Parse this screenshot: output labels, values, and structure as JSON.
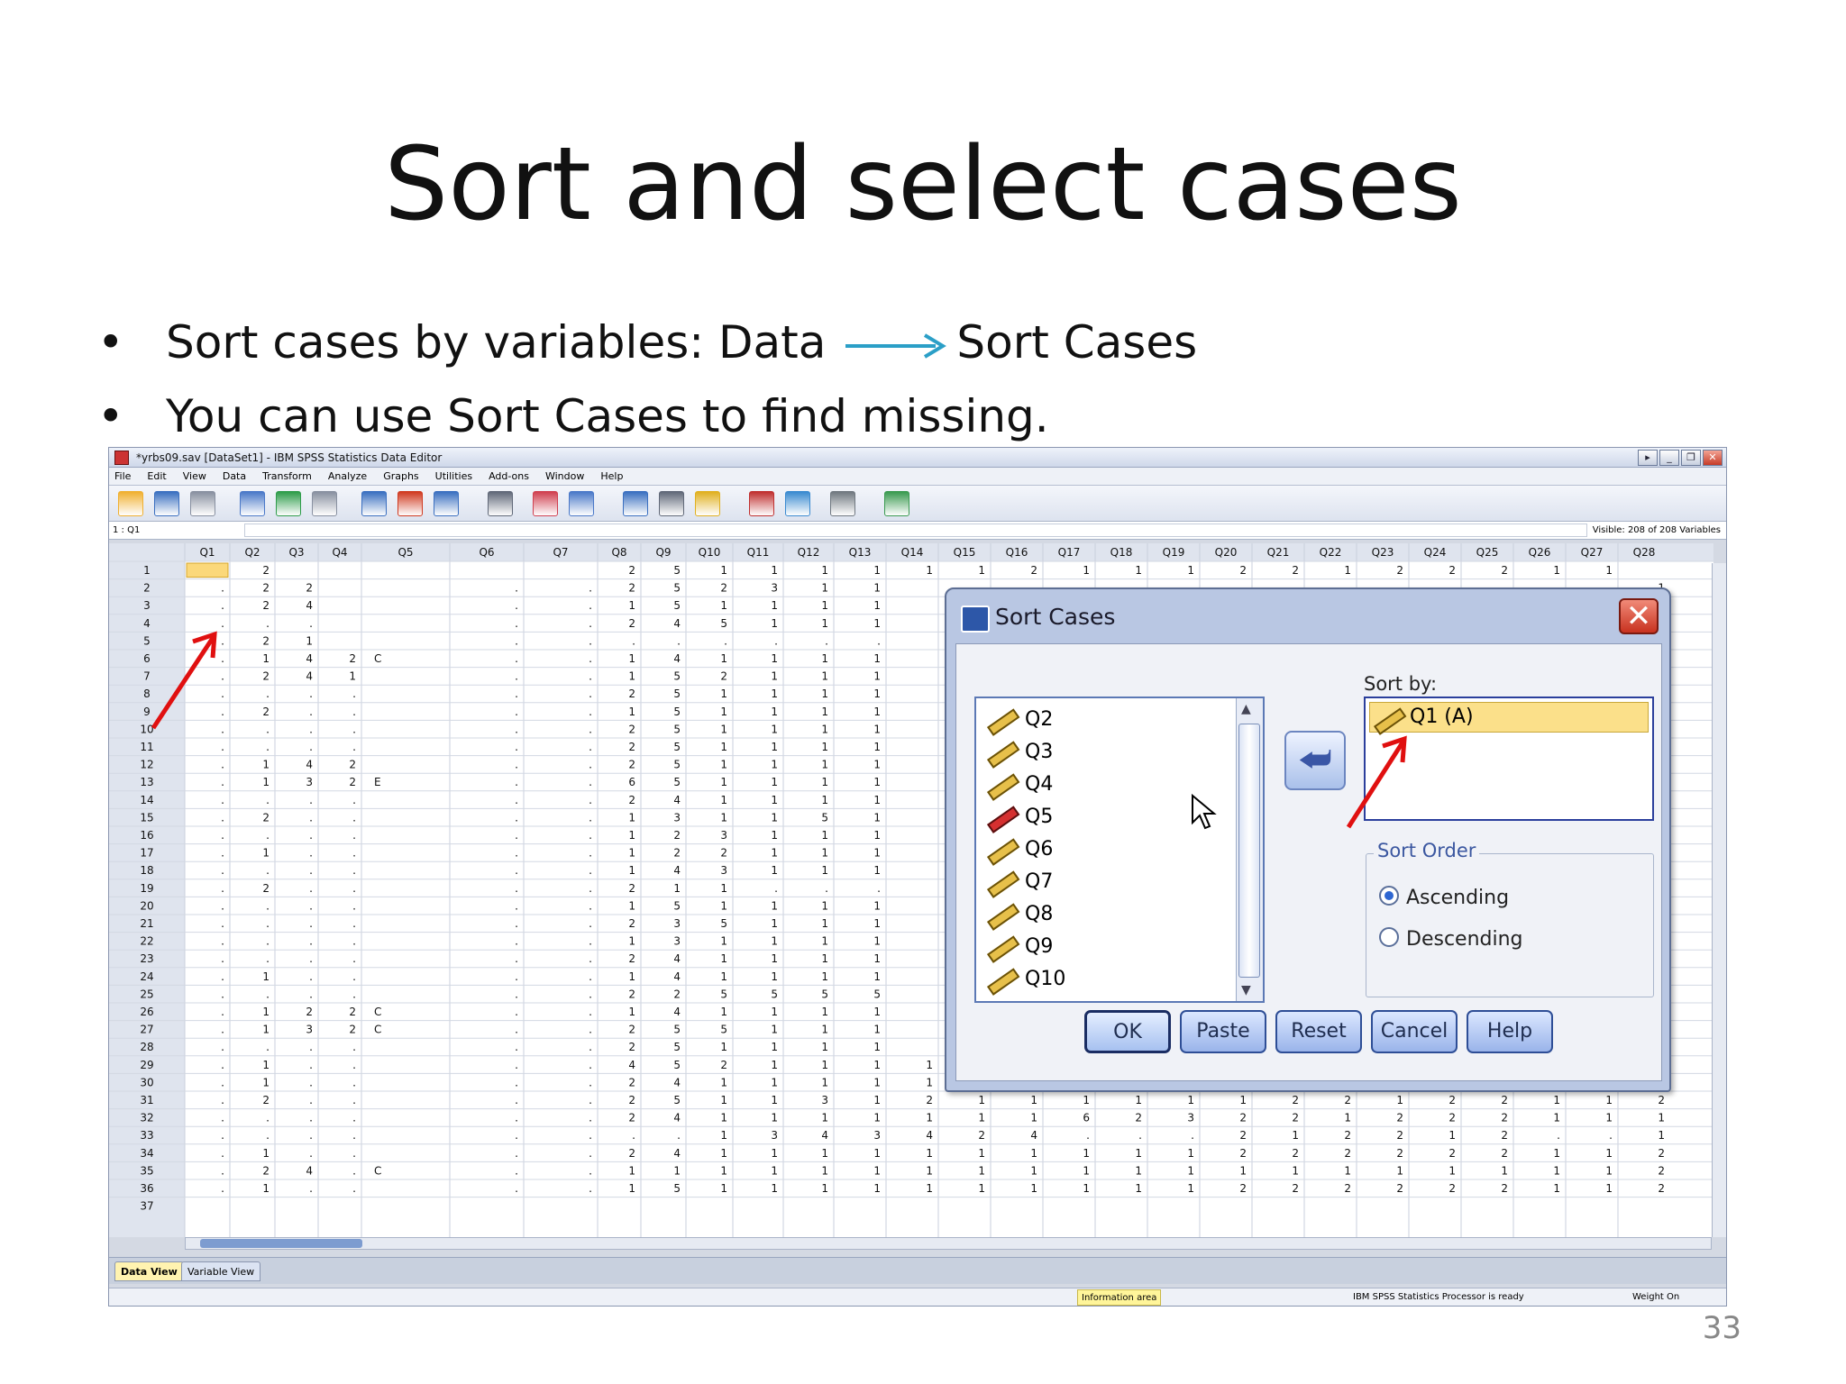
{
  "slide": {
    "title": "Sort and select cases",
    "bullets": [
      "Sort cases by variables: Data",
      "Sort Cases",
      "You can use Sort Cases to find missing."
    ],
    "page_number": "33",
    "bullet_dot": "•"
  },
  "spss": {
    "window_title": "*yrbs09.sav [DataSet1] - IBM SPSS Statistics Data Editor",
    "menu": [
      "File",
      "Edit",
      "View",
      "Data",
      "Transform",
      "Analyze",
      "Graphs",
      "Utilities",
      "Add-ons",
      "Window",
      "Help"
    ],
    "cell_ref": "1 : Q1",
    "visible": "Visible: 208 of 208 Variables",
    "columns": [
      "Q1",
      "Q2",
      "Q3",
      "Q4",
      "Q5",
      "Q6",
      "Q7",
      "Q8",
      "Q9",
      "Q10",
      "Q11",
      "Q12",
      "Q13",
      "Q14",
      "Q15",
      "Q16",
      "Q17",
      "Q18",
      "Q19",
      "Q20",
      "Q21",
      "Q22",
      "Q23",
      "Q24",
      "Q25",
      "Q26",
      "Q27",
      "Q28"
    ],
    "tabs": [
      "Data View",
      "Variable View"
    ],
    "status": {
      "info": "Information area",
      "processor": "IBM SPSS Statistics Processor is ready",
      "weight": "Weight On"
    }
  },
  "dialog": {
    "title": "Sort Cases",
    "variables": [
      "Q2",
      "Q3",
      "Q4",
      "Q5",
      "Q6",
      "Q7",
      "Q8",
      "Q9",
      "Q10"
    ],
    "sort_by_label": "Sort by:",
    "sort_by_items": [
      "Q1 (A)"
    ],
    "sort_order_label": "Sort Order",
    "ascending": "Ascending",
    "descending": "Descending",
    "buttons": {
      "ok": "OK",
      "paste": "Paste",
      "reset": "Reset",
      "cancel": "Cancel",
      "help": "Help"
    }
  },
  "rows": [
    [
      "",
      "2",
      "",
      "",
      "",
      "",
      "",
      "2",
      "5",
      "1",
      "1",
      "1",
      "1",
      "1",
      "1",
      "2",
      "1",
      "1",
      "1",
      "2",
      "2",
      "1",
      "2",
      "2",
      "2",
      "1",
      "1",
      ""
    ],
    [
      ".",
      "2",
      "2",
      "",
      "",
      ".",
      ".",
      "2",
      "5",
      "2",
      "3",
      "1",
      "1",
      "",
      "",
      "",
      "",
      "",
      "",
      "",
      "",
      "",
      "",
      "",
      "",
      "",
      "",
      "1"
    ],
    [
      ".",
      "2",
      "4",
      "",
      "",
      ".",
      ".",
      "1",
      "5",
      "1",
      "1",
      "1",
      "1",
      "",
      "",
      "",
      "",
      "",
      "",
      "",
      "",
      "",
      "",
      "",
      "",
      "",
      "",
      "2"
    ],
    [
      ".",
      ".",
      ".",
      "",
      "",
      ".",
      ".",
      "2",
      "4",
      "5",
      "1",
      "1",
      "1",
      "",
      "",
      "",
      "",
      "",
      "",
      "",
      "",
      "",
      "",
      "",
      "",
      "",
      "",
      "2"
    ],
    [
      ".",
      "2",
      "1",
      "",
      "",
      ".",
      ".",
      ".",
      ".",
      ".",
      ".",
      ".",
      ".",
      "",
      "",
      "",
      "",
      "",
      "",
      "",
      "",
      "",
      "",
      "",
      "",
      "",
      "",
      "1"
    ],
    [
      ".",
      "1",
      "4",
      "2",
      "C",
      ".",
      ".",
      "1",
      "4",
      "1",
      "1",
      "1",
      "1",
      "",
      "",
      "",
      "",
      "",
      "",
      "",
      "",
      "",
      "",
      "",
      "",
      "",
      "",
      "2"
    ],
    [
      ".",
      "2",
      "4",
      "1",
      "",
      ".",
      ".",
      "1",
      "5",
      "2",
      "1",
      "1",
      "1",
      "",
      "",
      "",
      "",
      "",
      "",
      "",
      "",
      "",
      "",
      "",
      "",
      "",
      "",
      "2"
    ],
    [
      ".",
      ".",
      ".",
      ".",
      "",
      ".",
      ".",
      "2",
      "5",
      "1",
      "1",
      "1",
      "1",
      "",
      "",
      "",
      "",
      "",
      "",
      "",
      "",
      "",
      "",
      "",
      "",
      "",
      "",
      "1"
    ],
    [
      ".",
      "2",
      ".",
      ".",
      "",
      ".",
      ".",
      "1",
      "5",
      "1",
      "1",
      "1",
      "1",
      "",
      "",
      "",
      "",
      "",
      "",
      "",
      "",
      "",
      "",
      "",
      "",
      "",
      "",
      "2"
    ],
    [
      ".",
      ".",
      ".",
      ".",
      "",
      ".",
      ".",
      "2",
      "5",
      "1",
      "1",
      "1",
      "1",
      "",
      "",
      "",
      "",
      "",
      "",
      "",
      "",
      "",
      "",
      "",
      "",
      "",
      "",
      "2"
    ],
    [
      ".",
      ".",
      ".",
      ".",
      "",
      ".",
      ".",
      "2",
      "5",
      "1",
      "1",
      "1",
      "1",
      "",
      "",
      "",
      "",
      "",
      "",
      "",
      "",
      "",
      "",
      "",
      "",
      "",
      "",
      "1"
    ],
    [
      ".",
      "1",
      "4",
      "2",
      "",
      ".",
      ".",
      "2",
      "5",
      "1",
      "1",
      "1",
      "1",
      "",
      "",
      "",
      "",
      "",
      "",
      "",
      "",
      "",
      "",
      "",
      "",
      "",
      "",
      "2"
    ],
    [
      ".",
      "1",
      "3",
      "2",
      "E",
      ".",
      ".",
      "6",
      "5",
      "1",
      "1",
      "1",
      "1",
      "",
      "",
      "",
      "",
      "",
      "",
      "",
      "",
      "",
      "",
      "",
      "",
      "",
      "",
      "2"
    ],
    [
      ".",
      ".",
      ".",
      ".",
      "",
      ".",
      ".",
      "2",
      "4",
      "1",
      "1",
      "1",
      "1",
      "",
      "",
      "",
      "",
      "",
      "",
      "",
      "",
      "",
      "",
      "",
      "",
      "",
      "",
      "1"
    ],
    [
      ".",
      "2",
      ".",
      ".",
      "",
      ".",
      ".",
      "1",
      "3",
      "1",
      "1",
      "5",
      "1",
      "",
      "",
      "",
      "",
      "",
      "",
      "",
      "",
      "",
      "",
      "",
      "",
      "",
      "",
      "1"
    ],
    [
      ".",
      ".",
      ".",
      ".",
      "",
      ".",
      ".",
      "1",
      "2",
      "3",
      "1",
      "1",
      "1",
      "",
      "",
      "",
      "",
      "",
      "",
      "",
      "",
      "",
      "",
      "",
      "",
      "",
      "",
      "1"
    ],
    [
      ".",
      "1",
      ".",
      ".",
      "",
      ".",
      ".",
      "1",
      "2",
      "2",
      "1",
      "1",
      "1",
      "",
      "",
      "",
      "",
      "",
      "",
      "",
      "",
      "",
      "",
      "",
      "",
      "",
      "",
      "1"
    ],
    [
      ".",
      ".",
      ".",
      ".",
      "",
      ".",
      ".",
      "1",
      "4",
      "3",
      "1",
      "1",
      "1",
      "",
      "",
      "",
      "",
      "",
      "",
      "",
      "",
      "",
      "",
      "",
      "",
      "",
      "",
      "1"
    ],
    [
      ".",
      "2",
      ".",
      ".",
      "",
      ".",
      ".",
      "2",
      "1",
      "1",
      ".",
      ".",
      ".",
      "",
      "",
      "",
      "",
      "",
      "",
      "",
      "",
      "",
      "",
      "",
      "",
      "",
      "",
      "1"
    ],
    [
      ".",
      ".",
      ".",
      ".",
      "",
      ".",
      ".",
      "1",
      "5",
      "1",
      "1",
      "1",
      "1",
      "",
      "",
      "",
      "",
      "",
      "",
      "",
      "",
      "",
      "",
      "",
      "",
      "",
      "",
      "1"
    ],
    [
      ".",
      ".",
      ".",
      ".",
      "",
      ".",
      ".",
      "2",
      "3",
      "5",
      "1",
      "1",
      "1",
      "",
      "",
      "",
      "",
      "",
      "",
      "",
      "",
      "",
      "",
      "",
      "",
      "",
      "",
      "1"
    ],
    [
      ".",
      ".",
      ".",
      ".",
      "",
      ".",
      ".",
      "1",
      "3",
      "1",
      "1",
      "1",
      "1",
      "",
      "",
      "",
      "",
      "",
      "",
      "",
      "",
      "",
      "",
      "",
      "",
      "",
      "",
      "2"
    ],
    [
      ".",
      ".",
      ".",
      ".",
      "",
      ".",
      ".",
      "2",
      "4",
      "1",
      "1",
      "1",
      "1",
      "",
      "",
      "",
      "",
      "",
      "",
      "",
      "",
      "",
      "",
      "",
      "",
      "",
      "",
      "2"
    ],
    [
      ".",
      "1",
      ".",
      ".",
      "",
      ".",
      ".",
      "1",
      "4",
      "1",
      "1",
      "1",
      "1",
      "",
      "",
      "",
      "",
      "",
      "",
      "",
      "",
      "",
      "",
      "",
      "",
      "",
      "",
      "2"
    ],
    [
      ".",
      ".",
      ".",
      ".",
      "",
      ".",
      ".",
      "2",
      "2",
      "5",
      "5",
      "5",
      "5",
      "",
      "",
      "",
      "",
      "",
      "",
      "",
      "",
      "",
      "",
      "",
      "",
      "",
      "",
      "1"
    ],
    [
      ".",
      "1",
      "2",
      "2",
      "C",
      ".",
      ".",
      "1",
      "4",
      "1",
      "1",
      "1",
      "1",
      "",
      "",
      "",
      "",
      "",
      "",
      "",
      "",
      "",
      "",
      "",
      "",
      "",
      "",
      "2"
    ],
    [
      ".",
      "1",
      "3",
      "2",
      "C",
      ".",
      ".",
      "2",
      "5",
      "5",
      "1",
      "1",
      "1",
      "",
      "",
      "",
      "",
      "",
      "",
      "",
      "",
      "",
      "",
      "",
      "",
      "",
      "",
      "2"
    ],
    [
      ".",
      ".",
      ".",
      ".",
      "",
      ".",
      ".",
      "2",
      "5",
      "1",
      "1",
      "1",
      "1",
      "",
      "",
      "",
      "",
      "",
      "",
      "",
      "",
      "",
      "",
      "",
      "",
      "",
      "",
      "2"
    ],
    [
      ".",
      "1",
      ".",
      ".",
      "",
      ".",
      ".",
      "4",
      "5",
      "2",
      "1",
      "1",
      "1",
      "1",
      "1",
      "1",
      "1",
      "1",
      "1",
      "2",
      "2",
      "2",
      "2",
      "2",
      "2",
      "1",
      "1",
      "2"
    ],
    [
      ".",
      "1",
      ".",
      ".",
      "",
      ".",
      ".",
      "2",
      "4",
      "1",
      "1",
      "1",
      "1",
      "1",
      "1",
      "1",
      "1",
      "1",
      "1",
      "2",
      "2",
      "2",
      "1",
      "2",
      "2",
      "1",
      "1",
      "2"
    ],
    [
      ".",
      "2",
      ".",
      ".",
      "",
      ".",
      ".",
      "2",
      "5",
      "1",
      "1",
      "3",
      "1",
      "2",
      "1",
      "1",
      "1",
      "1",
      "1",
      "1",
      "2",
      "2",
      "1",
      "2",
      "2",
      "1",
      "1",
      "2"
    ],
    [
      ".",
      ".",
      ".",
      ".",
      "",
      ".",
      ".",
      "2",
      "4",
      "1",
      "1",
      "1",
      "1",
      "1",
      "1",
      "1",
      "6",
      "2",
      "3",
      "2",
      "2",
      "1",
      "2",
      "2",
      "2",
      "1",
      "1",
      "1"
    ],
    [
      ".",
      ".",
      ".",
      ".",
      "",
      ".",
      ".",
      ".",
      ".",
      "1",
      "3",
      "4",
      "3",
      "4",
      "2",
      "4",
      ".",
      ".",
      ".",
      "2",
      "1",
      "2",
      "2",
      "1",
      "2",
      ".",
      ".",
      "1"
    ],
    [
      ".",
      "1",
      ".",
      ".",
      "",
      ".",
      ".",
      "2",
      "4",
      "1",
      "1",
      "1",
      "1",
      "1",
      "1",
      "1",
      "1",
      "1",
      "1",
      "2",
      "2",
      "2",
      "2",
      "2",
      "2",
      "1",
      "1",
      "2"
    ],
    [
      ".",
      "2",
      "4",
      ".",
      "C",
      ".",
      ".",
      "1",
      "1",
      "1",
      "1",
      "1",
      "1",
      "1",
      "1",
      "1",
      "1",
      "1",
      "1",
      "1",
      "1",
      "1",
      "1",
      "1",
      "1",
      "1",
      "1",
      "2"
    ],
    [
      ".",
      "1",
      ".",
      ".",
      "",
      ".",
      ".",
      "1",
      "5",
      "1",
      "1",
      "1",
      "1",
      "1",
      "1",
      "1",
      "1",
      "1",
      "1",
      "2",
      "2",
      "2",
      "2",
      "2",
      "2",
      "1",
      "1",
      "2"
    ]
  ]
}
